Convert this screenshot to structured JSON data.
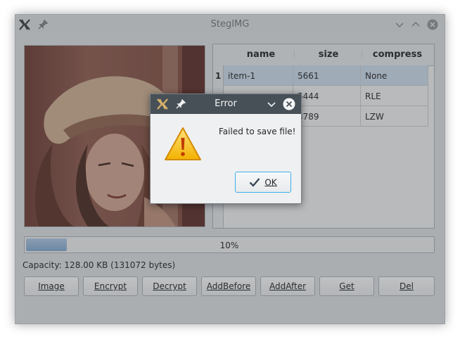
{
  "window": {
    "title": "StegIMG",
    "app_icon": "x-logo-icon",
    "pin_icon": "pin-icon",
    "controls": [
      "minimize-icon",
      "maximize-icon",
      "close-icon"
    ]
  },
  "table": {
    "headers": [
      "name",
      "size",
      "compress"
    ],
    "rows": [
      {
        "num": "1",
        "name": "item-1",
        "size": "5661",
        "compress": "None"
      },
      {
        "num": "",
        "name": "",
        "size": "5444",
        "compress": "RLE"
      },
      {
        "num": "",
        "name": "",
        "size": "3789",
        "compress": "LZW"
      }
    ]
  },
  "progress": {
    "text": "10%",
    "value": 0.1
  },
  "capacity": "Capacity: 128.00 KB (131072 bytes)",
  "buttons": [
    "Image",
    "Encrypt",
    "Decrypt",
    "AddBefore",
    "AddAfter",
    "Get",
    "Del"
  ],
  "dialog": {
    "title": "Error",
    "message": "Failed to save file!",
    "ok_label": "OK",
    "icon": "warning-icon"
  },
  "colors": {
    "accent": "#3daee9",
    "dialog_titlebar": "#475057",
    "progress": "#7fa3c8"
  }
}
